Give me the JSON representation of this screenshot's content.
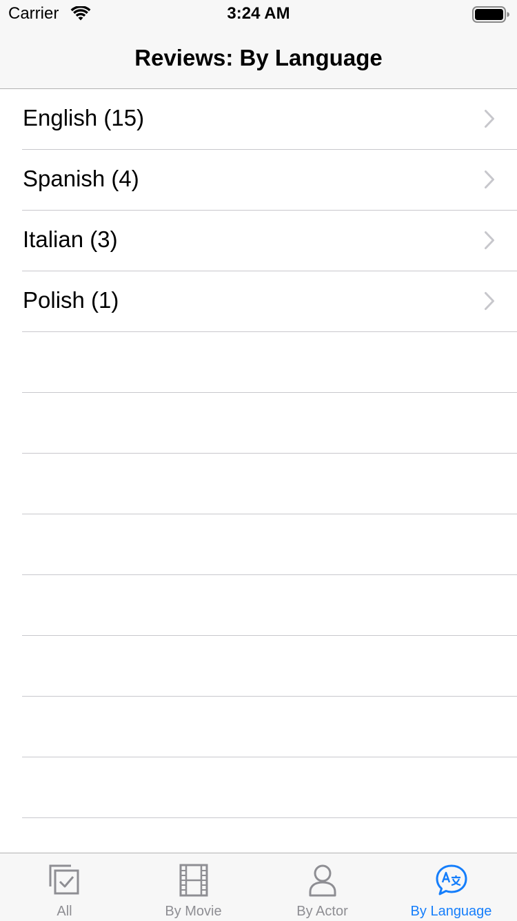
{
  "status_bar": {
    "carrier": "Carrier",
    "time": "3:24 AM"
  },
  "nav": {
    "title": "Reviews: By Language"
  },
  "list": {
    "items": [
      {
        "label": "English (15)"
      },
      {
        "label": "Spanish (4)"
      },
      {
        "label": "Italian (3)"
      },
      {
        "label": "Polish (1)"
      }
    ],
    "empty_rows": 9
  },
  "tab_bar": {
    "tabs": [
      {
        "label": "All",
        "icon": "checkbox-stack-icon",
        "active": false
      },
      {
        "label": "By Movie",
        "icon": "film-strip-icon",
        "active": false
      },
      {
        "label": "By Actor",
        "icon": "person-icon",
        "active": false
      },
      {
        "label": "By Language",
        "icon": "translate-bubble-icon",
        "active": true
      }
    ]
  },
  "colors": {
    "accent": "#157efb",
    "inactive": "#8e8e93",
    "separator": "#c8c7cc",
    "chrome_background": "#f7f7f7"
  }
}
